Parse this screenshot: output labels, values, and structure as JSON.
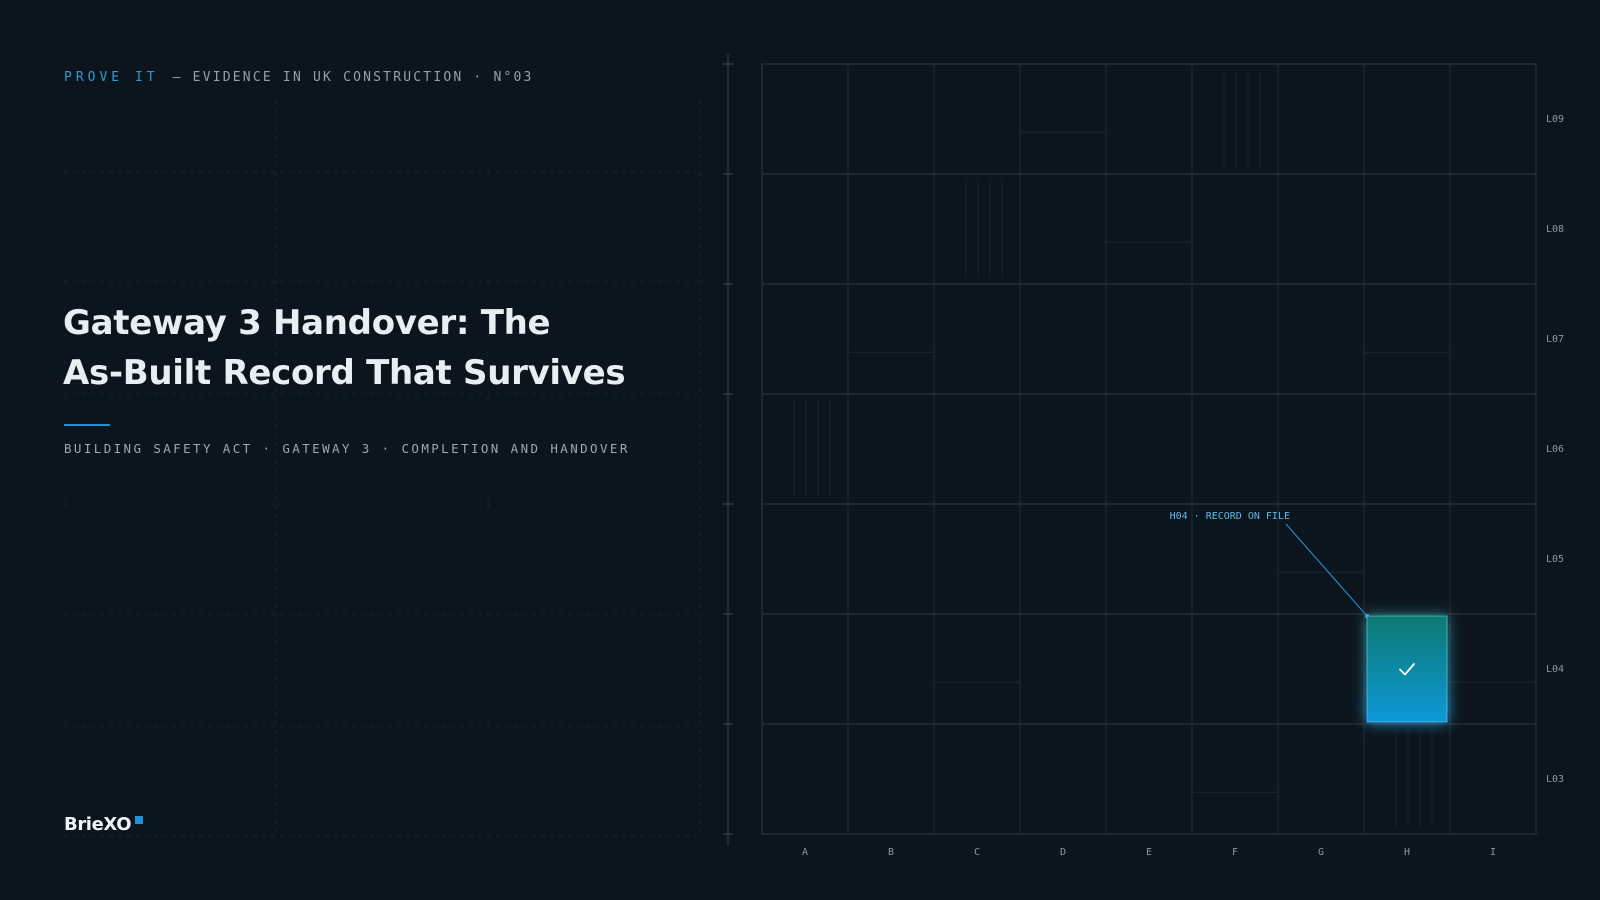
{
  "header": {
    "series_label": "PROVE IT",
    "series_rest": "— EVIDENCE IN UK CONSTRUCTION · N°03"
  },
  "title_lines": [
    "Gateway 3 Handover: The",
    "As-Built Record That Survives"
  ],
  "subtitle": "BUILDING SAFETY ACT · GATEWAY 3 · COMPLETION AND HANDOVER",
  "brand": {
    "name": "BrieXO"
  },
  "grid": {
    "columns": [
      "A",
      "B",
      "C",
      "D",
      "E",
      "F",
      "G",
      "H",
      "I"
    ],
    "levels": [
      "L09",
      "L08",
      "L07",
      "L06",
      "L05",
      "L04",
      "L03"
    ],
    "highlight": {
      "column": "H",
      "level": "L04",
      "label": "H04 · RECORD ON FILE",
      "icon": "check-icon",
      "gradient": [
        "#0b7a72",
        "#0e98d8"
      ]
    }
  },
  "colors": {
    "background": "#0c151d",
    "accent": "#2f9bd6",
    "grid_line": "#243441"
  }
}
